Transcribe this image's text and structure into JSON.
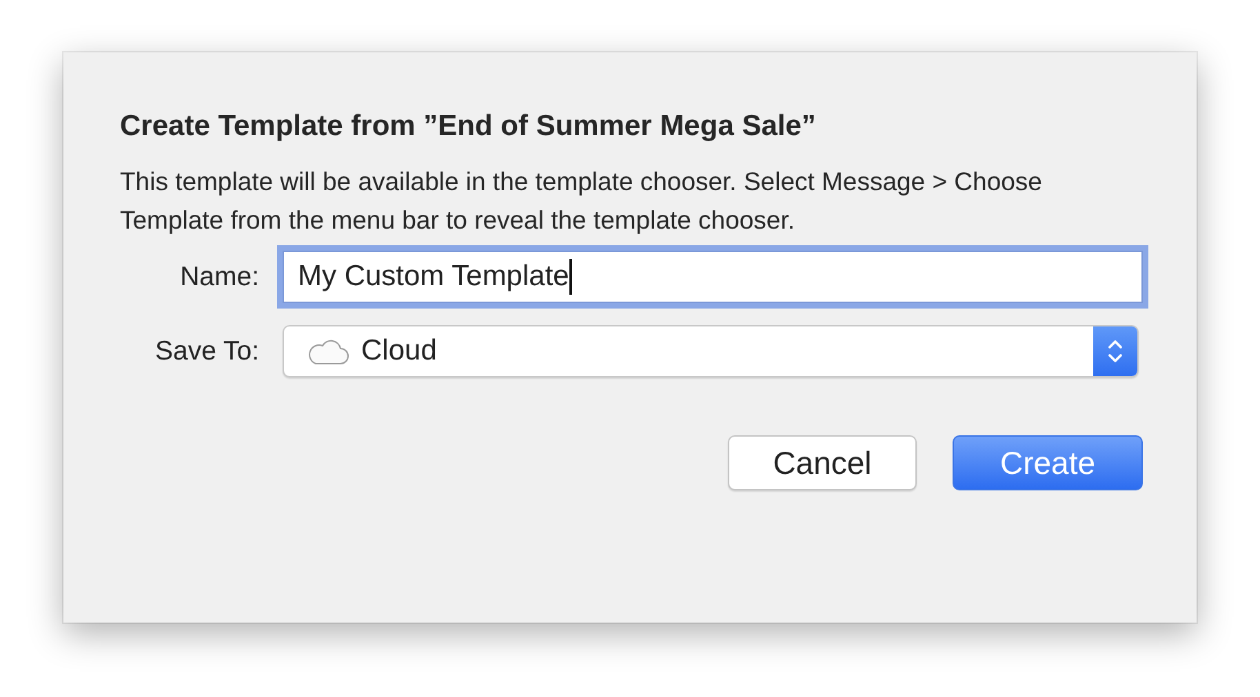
{
  "dialog": {
    "title": "Create Template from ”End of Summer Mega Sale”",
    "message": "This template will be available in the template chooser. Select Message > Choose Template from the menu bar to reveal the template chooser.",
    "fields": [
      {
        "kind": "text",
        "label": "Name:",
        "value": "My Custom Template",
        "focused": true
      },
      {
        "kind": "popup",
        "label": "Save To:",
        "value": "Cloud"
      }
    ],
    "buttons": [
      {
        "label": "Cancel",
        "kind": "normal"
      },
      {
        "label": "Create",
        "kind": "default"
      }
    ]
  }
}
